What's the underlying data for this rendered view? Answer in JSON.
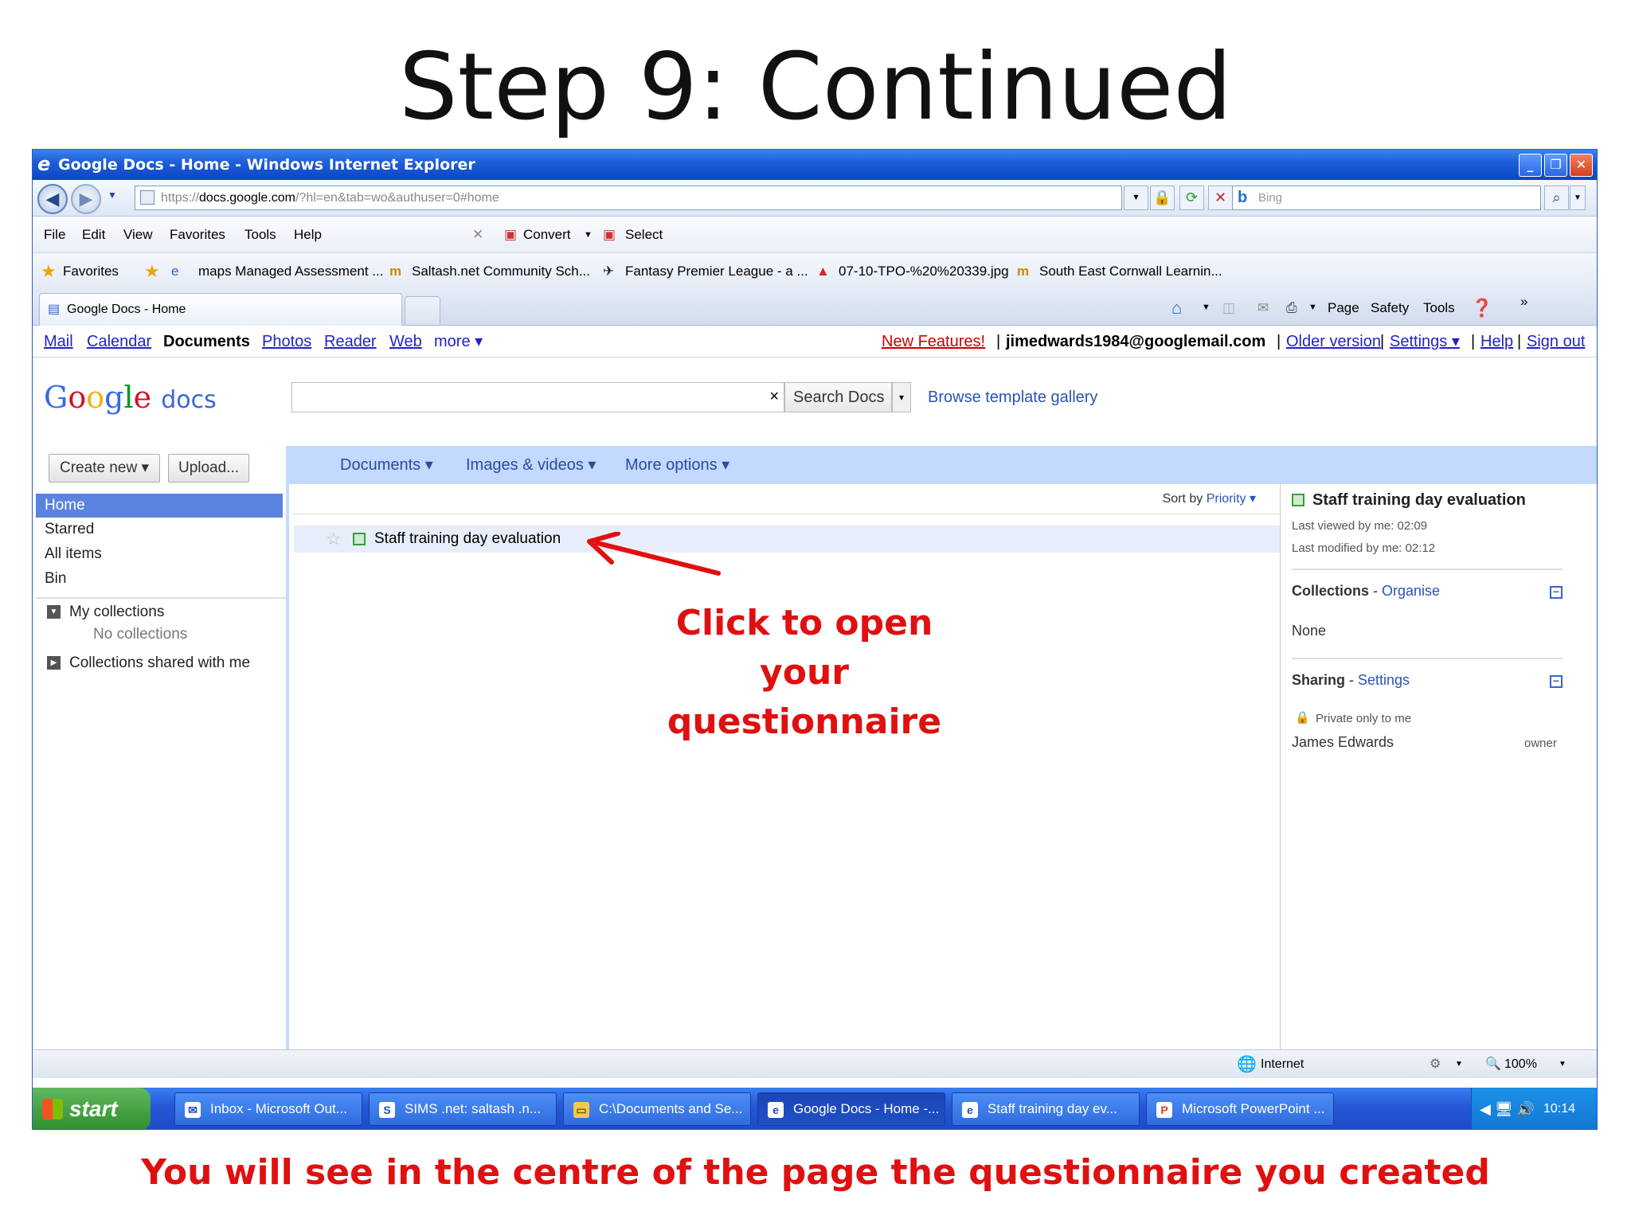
{
  "slide": {
    "title": "Step 9: Continued",
    "callout_line1": "Click to open your",
    "callout_line2": "questionnaire",
    "caption": "You will see in the centre of the page the questionnaire you created"
  },
  "window": {
    "title": "Google Docs - Home - Windows Internet Explorer",
    "minimize": "_",
    "restore": "❐",
    "close": "✕"
  },
  "address": {
    "proto": "https://",
    "domain": "docs.google.com",
    "path": "/?hl=en&tab=wo&authuser=0#home",
    "search_placeholder": "Bing"
  },
  "menu": [
    "File",
    "Edit",
    "View",
    "Favorites",
    "Tools",
    "Help"
  ],
  "tools": {
    "convert": "Convert",
    "select": "Select"
  },
  "favorites": {
    "label": "Favorites",
    "items": [
      "maps Managed Assessment ...",
      "Saltash.net Community Sch...",
      "Fantasy Premier League - a ...",
      "07-10-TPO-%20%20339.jpg",
      "South East Cornwall Learnin..."
    ]
  },
  "tab": {
    "label": "Google Docs - Home"
  },
  "commandbar": {
    "page": "Page",
    "safety": "Safety",
    "tools": "Tools",
    "more": "»"
  },
  "gbar": {
    "mail": "Mail",
    "calendar": "Calendar",
    "documents": "Documents",
    "photos": "Photos",
    "reader": "Reader",
    "web": "Web",
    "more": "more ▾",
    "new_features": "New Features!",
    "sep": "|",
    "email": "jimedwards1984@googlemail.com",
    "older": "Older version",
    "settings": "Settings ▾",
    "help": "Help",
    "signout": "Sign out"
  },
  "logo": {
    "google": "Google",
    "docs": "docs"
  },
  "search": {
    "clear": "×",
    "button": "Search Docs",
    "dropdown": "▾",
    "template": "Browse template gallery"
  },
  "left": {
    "create_new": "Create new ▾",
    "upload": "Upload...",
    "nav": [
      "Home",
      "Starred",
      "All items",
      "Bin"
    ],
    "my_collections": "My collections",
    "no_collections": "No collections",
    "shared": "Collections shared with me"
  },
  "header": {
    "documents": "Documents ▾",
    "images": "Images & videos ▾",
    "more_options": "More options ▾"
  },
  "list": {
    "sort_label": "Sort by",
    "sort_value": "Priority ▾",
    "rows": [
      {
        "star": "☆",
        "name": "Staff training day evaluation"
      }
    ]
  },
  "details": {
    "title": "Staff training day evaluation",
    "last_viewed": "Last viewed by me: 02:09",
    "last_modified": "Last modified by me: 02:12",
    "collections": "Collections",
    "dash": " - ",
    "organise": "Organise",
    "collections_value": "None",
    "sharing": "Sharing",
    "settings": "Settings",
    "private": "Private only to me",
    "owner_name": "James Edwards",
    "owner_role": "owner"
  },
  "status": {
    "zone": "Internet",
    "zoom": "100%"
  },
  "taskbar": {
    "start": "start",
    "tasks": [
      "Inbox - Microsoft Out...",
      "SIMS .net: saltash .n...",
      "C:\\Documents and Se...",
      "Google Docs - Home -...",
      "Staff training day ev...",
      "Microsoft PowerPoint ..."
    ],
    "time": "10:14"
  }
}
